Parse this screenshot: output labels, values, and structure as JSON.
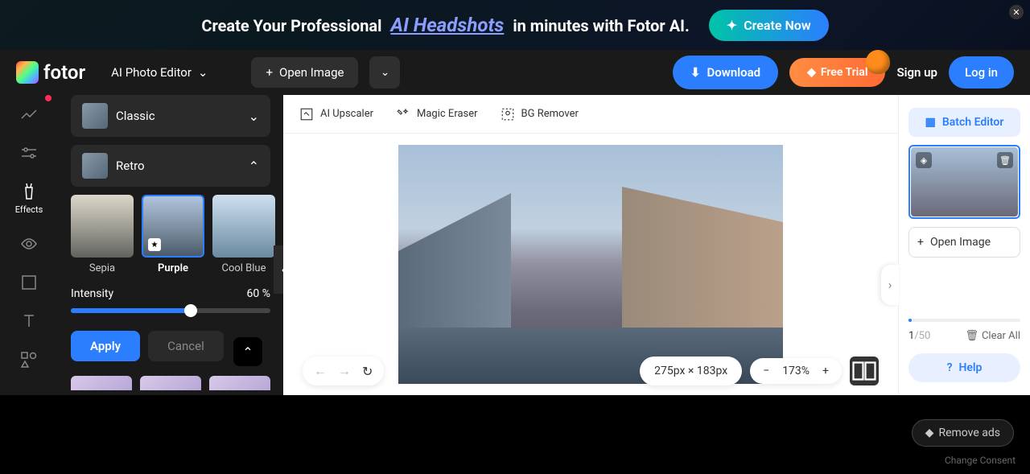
{
  "banner": {
    "text_before": "Create Your Professional",
    "highlight": "AI Headshots",
    "text_after": "in minutes with Fotor AI.",
    "cta": "Create Now"
  },
  "header": {
    "logo_text": "fotor",
    "editor_mode": "AI Photo Editor",
    "open_image": "Open Image",
    "download": "Download",
    "free_trial": "Free Trial",
    "sign_up": "Sign up",
    "log_in": "Log in"
  },
  "toolbar": {
    "effects_label": "Effects"
  },
  "sidebar": {
    "categories": [
      {
        "name": "Classic",
        "expanded": false
      },
      {
        "name": "Retro",
        "expanded": true
      }
    ],
    "filters": [
      {
        "label": "Sepia",
        "active": false
      },
      {
        "label": "Purple",
        "active": true,
        "premium": true
      },
      {
        "label": "Cool Blue",
        "active": false
      }
    ],
    "intensity_label": "Intensity",
    "intensity_value": "60 %",
    "apply": "Apply",
    "cancel": "Cancel"
  },
  "canvas_toolbar": {
    "upscaler": "AI Upscaler",
    "eraser": "Magic Eraser",
    "bg_remover": "BG Remover"
  },
  "canvas": {
    "dimensions": "275px × 183px",
    "zoom": "173%"
  },
  "right_panel": {
    "batch_editor": "Batch Editor",
    "open_image": "Open Image",
    "counter_current": "1",
    "counter_total": "/50",
    "clear_all": "Clear All",
    "help": "Help"
  },
  "footer": {
    "remove_ads": "Remove ads",
    "consent": "Change Consent"
  }
}
